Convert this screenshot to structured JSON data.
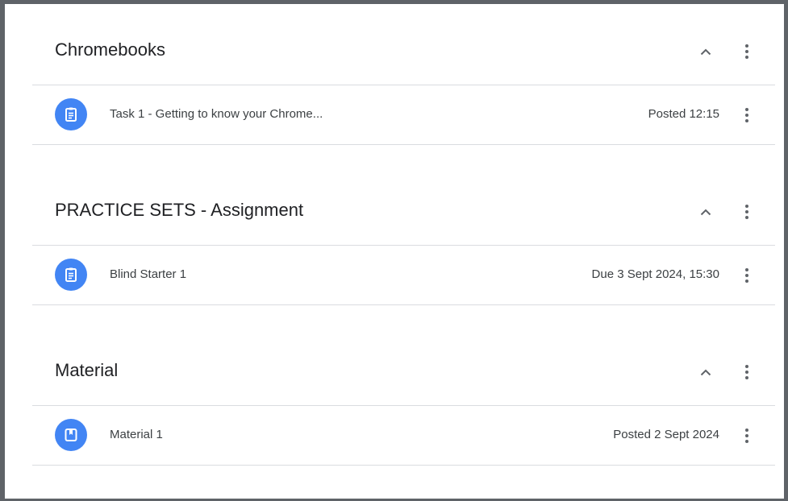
{
  "colors": {
    "accent": "#4285f4",
    "divider": "#dadce0",
    "text": "#202124",
    "frame": "#5f6368"
  },
  "topics": [
    {
      "title": "Chromebooks",
      "collapse_icon": "chevron-up-icon",
      "menu_icon": "more-vert-icon",
      "items": [
        {
          "icon": "assignment-icon",
          "title": "Task 1 - Getting to know your Chrome...",
          "meta": "Posted 12:15"
        }
      ]
    },
    {
      "title": "PRACTICE SETS - Assignment",
      "collapse_icon": "chevron-up-icon",
      "menu_icon": "more-vert-icon",
      "items": [
        {
          "icon": "assignment-icon",
          "title": "Blind Starter 1",
          "meta": "Due 3 Sept 2024, 15:30"
        }
      ]
    },
    {
      "title": "Material",
      "collapse_icon": "chevron-up-icon",
      "menu_icon": "more-vert-icon",
      "items": [
        {
          "icon": "material-icon",
          "title": "Material 1",
          "meta": "Posted 2 Sept 2024"
        }
      ]
    }
  ]
}
